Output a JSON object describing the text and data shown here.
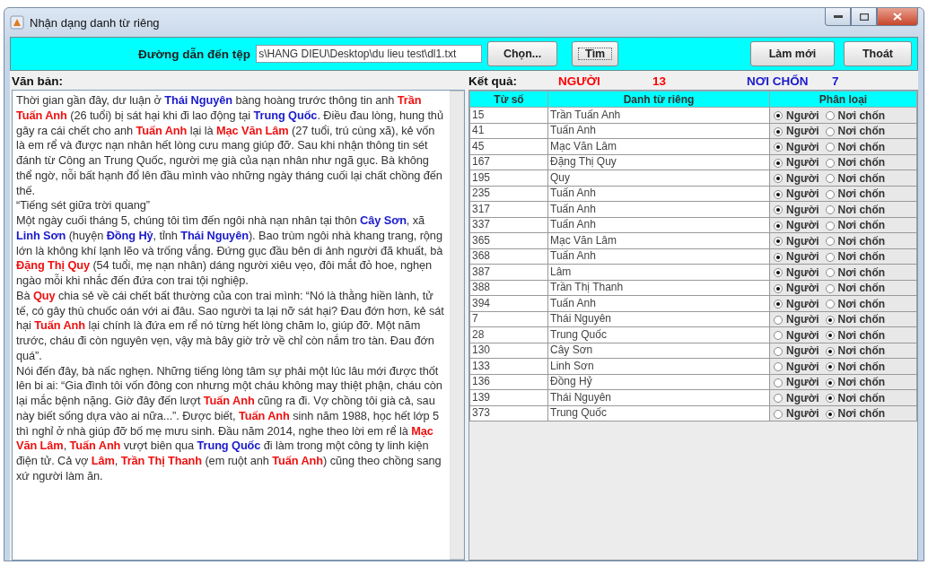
{
  "window": {
    "title": "Nhận dạng danh từ riêng"
  },
  "toolbar": {
    "path_label": "Đường dẫn đến tệp",
    "path_value": "s\\HANG DIEU\\Desktop\\du lieu test\\dl1.txt",
    "buttons": [
      {
        "label": "Chọn...",
        "focused": false
      },
      {
        "label": "Tìm",
        "focused": true
      }
    ],
    "right_buttons": [
      "Làm mới",
      "Thoát"
    ]
  },
  "text_panel": {
    "label": "Văn bản:",
    "paragraphs": [
      [
        {
          "text": "Thời gian gần đây, dư luận ở ",
          "kind": "plain"
        },
        {
          "text": "Thái Nguyên",
          "kind": "place"
        },
        {
          "text": " bàng hoàng trước thông tin anh ",
          "kind": "plain"
        },
        {
          "text": "Trần Tuấn Anh",
          "kind": "person"
        },
        {
          "text": " (26 tuổi) bị sát hại khi đi lao động tại ",
          "kind": "plain"
        },
        {
          "text": "Trung Quốc",
          "kind": "place"
        },
        {
          "text": ". Điều đau lòng, hung thủ gây ra cái chết cho anh ",
          "kind": "plain"
        },
        {
          "text": "Tuấn Anh",
          "kind": "person"
        },
        {
          "text": " lại là ",
          "kind": "plain"
        },
        {
          "text": "Mạc Văn Lâm",
          "kind": "person"
        },
        {
          "text": " (27 tuổi, trú cùng xã), kẻ vốn là em rể và được nạn nhân hết lòng cưu mang giúp đỡ. Sau khi nhận thông tin sét đánh từ Công an Trung Quốc, người mẹ già của nạn nhân như ngã gục. Bà không thể ngờ, nỗi bất hạnh đổ lên đầu mình vào những ngày tháng cuối lại chất chồng đến thế.",
          "kind": "plain"
        }
      ],
      [
        {
          "text": "“Tiếng sét giữa trời quang”",
          "kind": "plain"
        }
      ],
      [
        {
          "text": "Một ngày cuối tháng 5, chúng tôi tìm đến ngôi nhà nạn nhân tại thôn ",
          "kind": "plain"
        },
        {
          "text": "Cây Sơn",
          "kind": "place"
        },
        {
          "text": ", xã ",
          "kind": "plain"
        },
        {
          "text": "Linh Sơn",
          "kind": "place"
        },
        {
          "text": " (huyện ",
          "kind": "plain"
        },
        {
          "text": "Đồng Hỷ",
          "kind": "place"
        },
        {
          "text": ", tỉnh ",
          "kind": "plain"
        },
        {
          "text": "Thái Nguyên",
          "kind": "place"
        },
        {
          "text": "). Bao trùm ngôi nhà khang trang, rộng lớn là không khí lạnh lẽo và trống vắng. Đứng gục đầu bên di ảnh người đã khuất, bà ",
          "kind": "plain"
        },
        {
          "text": "Đặng Thị Quy",
          "kind": "person"
        },
        {
          "text": " (54 tuổi, mẹ nạn nhân) dáng người xiêu vẹo, đôi mắt đỏ hoe, nghẹn ngào mỗi khi nhắc đến đứa con trai tội nghiệp.",
          "kind": "plain"
        }
      ],
      [
        {
          "text": "Bà ",
          "kind": "plain"
        },
        {
          "text": "Quy",
          "kind": "person"
        },
        {
          "text": " chia sẻ về cái chết bất thường của con trai mình: “Nó là thằng hiền lành, tử tế, có gây thù chuốc oán với ai đâu. Sao người ta lại nỡ sát hại? Đau đớn hơn, kẻ sát hại ",
          "kind": "plain"
        },
        {
          "text": "Tuấn Anh",
          "kind": "person"
        },
        {
          "text": " lại chính là đứa em rể nó từng hết lòng chăm lo, giúp đỡ. Một năm trước, cháu đi còn nguyên vẹn, vậy mà bây giờ trở về chỉ còn nắm tro tàn. Đau đớn quá”.",
          "kind": "plain"
        }
      ],
      [
        {
          "text": "Nói đến đây, bà nấc nghẹn. Những tiếng lòng tâm sự phải một lúc lâu mới được thốt lên bi ai: “Gia đình tôi vốn đông con nhưng một cháu không may thiệt phận, cháu còn lại mắc bệnh nặng. Giờ đây đến lượt ",
          "kind": "plain"
        },
        {
          "text": "Tuấn Anh",
          "kind": "person"
        },
        {
          "text": " cũng ra đi. Vợ chồng tôi già cả, sau này biết sống dựa vào ai nữa...”. Được biết, ",
          "kind": "plain"
        },
        {
          "text": "Tuấn Anh",
          "kind": "person"
        },
        {
          "text": " sinh năm 1988, học hết lớp 5 thì nghỉ ở nhà giúp đỡ bố mẹ mưu sinh. Đầu năm 2014, nghe theo lời em rể là ",
          "kind": "plain"
        },
        {
          "text": "Mạc Văn Lâm",
          "kind": "person"
        },
        {
          "text": ", ",
          "kind": "plain"
        },
        {
          "text": "Tuấn Anh",
          "kind": "person"
        },
        {
          "text": " vượt biên qua ",
          "kind": "plain"
        },
        {
          "text": "Trung Quốc",
          "kind": "place"
        },
        {
          "text": " đi làm trong một công ty linh kiện điện tử. Cả vợ ",
          "kind": "plain"
        },
        {
          "text": "Lâm",
          "kind": "person"
        },
        {
          "text": ", ",
          "kind": "plain"
        },
        {
          "text": "Trần Thị Thanh",
          "kind": "person"
        },
        {
          "text": " (em ruột anh ",
          "kind": "plain"
        },
        {
          "text": "Tuấn Anh",
          "kind": "person"
        },
        {
          "text": ") cũng theo chồng sang xứ người làm ăn.",
          "kind": "plain"
        }
      ]
    ]
  },
  "results": {
    "label": "Kết quả:",
    "counts": [
      {
        "label": "NGƯỜI",
        "count": "13",
        "color": "#ff0000"
      },
      {
        "label": "NƠI CHỐN",
        "count": "7",
        "color": "#1a1acc"
      }
    ]
  },
  "table": {
    "columns": [
      "Từ số",
      "Danh từ riêng",
      "Phân loại"
    ],
    "rows": [
      {
        "index": "15",
        "name": "Trần Tuấn Anh",
        "options": [
          {
            "label": "Người",
            "selected": true
          },
          {
            "label": "Nơi chốn",
            "selected": false
          }
        ]
      },
      {
        "index": "41",
        "name": "Tuấn Anh",
        "options": [
          {
            "label": "Người",
            "selected": true
          },
          {
            "label": "Nơi chốn",
            "selected": false
          }
        ]
      },
      {
        "index": "45",
        "name": "Mạc Văn Lâm",
        "options": [
          {
            "label": "Người",
            "selected": true
          },
          {
            "label": "Nơi chốn",
            "selected": false
          }
        ]
      },
      {
        "index": "167",
        "name": "Đặng Thị Quy",
        "options": [
          {
            "label": "Người",
            "selected": true
          },
          {
            "label": "Nơi chốn",
            "selected": false
          }
        ]
      },
      {
        "index": "195",
        "name": "Quy",
        "options": [
          {
            "label": "Người",
            "selected": true
          },
          {
            "label": "Nơi chốn",
            "selected": false
          }
        ]
      },
      {
        "index": "235",
        "name": "Tuấn Anh",
        "options": [
          {
            "label": "Người",
            "selected": true
          },
          {
            "label": "Nơi chốn",
            "selected": false
          }
        ]
      },
      {
        "index": "317",
        "name": "Tuấn Anh",
        "options": [
          {
            "label": "Người",
            "selected": true
          },
          {
            "label": "Nơi chốn",
            "selected": false
          }
        ]
      },
      {
        "index": "337",
        "name": "Tuấn Anh",
        "options": [
          {
            "label": "Người",
            "selected": true
          },
          {
            "label": "Nơi chốn",
            "selected": false
          }
        ]
      },
      {
        "index": "365",
        "name": "Mạc Văn Lâm",
        "options": [
          {
            "label": "Người",
            "selected": true
          },
          {
            "label": "Nơi chốn",
            "selected": false
          }
        ]
      },
      {
        "index": "368",
        "name": "Tuấn Anh",
        "options": [
          {
            "label": "Người",
            "selected": true
          },
          {
            "label": "Nơi chốn",
            "selected": false
          }
        ]
      },
      {
        "index": "387",
        "name": "Lâm",
        "options": [
          {
            "label": "Người",
            "selected": true
          },
          {
            "label": "Nơi chốn",
            "selected": false
          }
        ]
      },
      {
        "index": "388",
        "name": "Trần Thị Thanh",
        "options": [
          {
            "label": "Người",
            "selected": true
          },
          {
            "label": "Nơi chốn",
            "selected": false
          }
        ]
      },
      {
        "index": "394",
        "name": "Tuấn Anh",
        "options": [
          {
            "label": "Người",
            "selected": true
          },
          {
            "label": "Nơi chốn",
            "selected": false
          }
        ]
      },
      {
        "index": "7",
        "name": "Thái Nguyên",
        "options": [
          {
            "label": "Người",
            "selected": false
          },
          {
            "label": "Nơi chốn",
            "selected": true
          }
        ]
      },
      {
        "index": "28",
        "name": "Trung Quốc",
        "options": [
          {
            "label": "Người",
            "selected": false
          },
          {
            "label": "Nơi chốn",
            "selected": true
          }
        ]
      },
      {
        "index": "130",
        "name": "Cây Sơn",
        "options": [
          {
            "label": "Người",
            "selected": false
          },
          {
            "label": "Nơi chốn",
            "selected": true
          }
        ]
      },
      {
        "index": "133",
        "name": "Linh Sơn",
        "options": [
          {
            "label": "Người",
            "selected": false
          },
          {
            "label": "Nơi chốn",
            "selected": true
          }
        ]
      },
      {
        "index": "136",
        "name": "Đồng Hỷ",
        "options": [
          {
            "label": "Người",
            "selected": false
          },
          {
            "label": "Nơi chốn",
            "selected": true
          }
        ]
      },
      {
        "index": "139",
        "name": "Thái Nguyên",
        "options": [
          {
            "label": "Người",
            "selected": false
          },
          {
            "label": "Nơi chốn",
            "selected": true
          }
        ]
      },
      {
        "index": "373",
        "name": "Trung Quốc",
        "options": [
          {
            "label": "Người",
            "selected": false
          },
          {
            "label": "Nơi chốn",
            "selected": true
          }
        ]
      }
    ]
  }
}
